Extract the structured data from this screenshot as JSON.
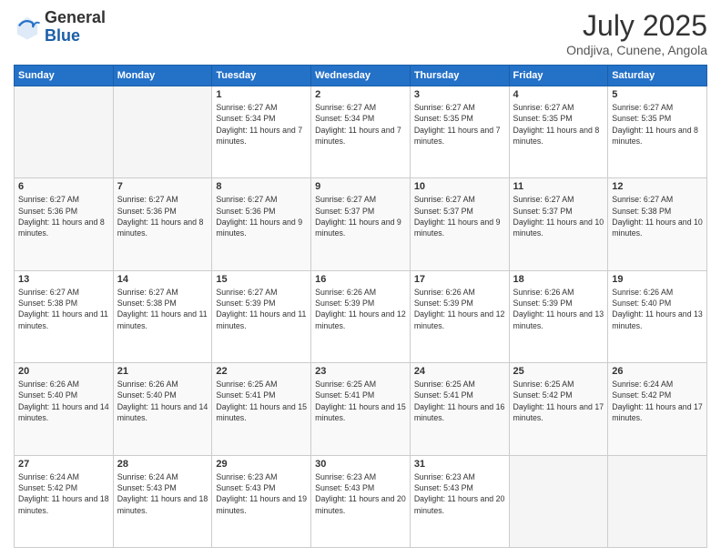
{
  "header": {
    "logo_line1": "General",
    "logo_line2": "Blue",
    "month": "July 2025",
    "location": "Ondjiva, Cunene, Angola"
  },
  "weekdays": [
    "Sunday",
    "Monday",
    "Tuesday",
    "Wednesday",
    "Thursday",
    "Friday",
    "Saturday"
  ],
  "weeks": [
    [
      {
        "day": "",
        "info": ""
      },
      {
        "day": "",
        "info": ""
      },
      {
        "day": "1",
        "info": "Sunrise: 6:27 AM\nSunset: 5:34 PM\nDaylight: 11 hours and 7 minutes."
      },
      {
        "day": "2",
        "info": "Sunrise: 6:27 AM\nSunset: 5:34 PM\nDaylight: 11 hours and 7 minutes."
      },
      {
        "day": "3",
        "info": "Sunrise: 6:27 AM\nSunset: 5:35 PM\nDaylight: 11 hours and 7 minutes."
      },
      {
        "day": "4",
        "info": "Sunrise: 6:27 AM\nSunset: 5:35 PM\nDaylight: 11 hours and 8 minutes."
      },
      {
        "day": "5",
        "info": "Sunrise: 6:27 AM\nSunset: 5:35 PM\nDaylight: 11 hours and 8 minutes."
      }
    ],
    [
      {
        "day": "6",
        "info": "Sunrise: 6:27 AM\nSunset: 5:36 PM\nDaylight: 11 hours and 8 minutes."
      },
      {
        "day": "7",
        "info": "Sunrise: 6:27 AM\nSunset: 5:36 PM\nDaylight: 11 hours and 8 minutes."
      },
      {
        "day": "8",
        "info": "Sunrise: 6:27 AM\nSunset: 5:36 PM\nDaylight: 11 hours and 9 minutes."
      },
      {
        "day": "9",
        "info": "Sunrise: 6:27 AM\nSunset: 5:37 PM\nDaylight: 11 hours and 9 minutes."
      },
      {
        "day": "10",
        "info": "Sunrise: 6:27 AM\nSunset: 5:37 PM\nDaylight: 11 hours and 9 minutes."
      },
      {
        "day": "11",
        "info": "Sunrise: 6:27 AM\nSunset: 5:37 PM\nDaylight: 11 hours and 10 minutes."
      },
      {
        "day": "12",
        "info": "Sunrise: 6:27 AM\nSunset: 5:38 PM\nDaylight: 11 hours and 10 minutes."
      }
    ],
    [
      {
        "day": "13",
        "info": "Sunrise: 6:27 AM\nSunset: 5:38 PM\nDaylight: 11 hours and 11 minutes."
      },
      {
        "day": "14",
        "info": "Sunrise: 6:27 AM\nSunset: 5:38 PM\nDaylight: 11 hours and 11 minutes."
      },
      {
        "day": "15",
        "info": "Sunrise: 6:27 AM\nSunset: 5:39 PM\nDaylight: 11 hours and 11 minutes."
      },
      {
        "day": "16",
        "info": "Sunrise: 6:26 AM\nSunset: 5:39 PM\nDaylight: 11 hours and 12 minutes."
      },
      {
        "day": "17",
        "info": "Sunrise: 6:26 AM\nSunset: 5:39 PM\nDaylight: 11 hours and 12 minutes."
      },
      {
        "day": "18",
        "info": "Sunrise: 6:26 AM\nSunset: 5:39 PM\nDaylight: 11 hours and 13 minutes."
      },
      {
        "day": "19",
        "info": "Sunrise: 6:26 AM\nSunset: 5:40 PM\nDaylight: 11 hours and 13 minutes."
      }
    ],
    [
      {
        "day": "20",
        "info": "Sunrise: 6:26 AM\nSunset: 5:40 PM\nDaylight: 11 hours and 14 minutes."
      },
      {
        "day": "21",
        "info": "Sunrise: 6:26 AM\nSunset: 5:40 PM\nDaylight: 11 hours and 14 minutes."
      },
      {
        "day": "22",
        "info": "Sunrise: 6:25 AM\nSunset: 5:41 PM\nDaylight: 11 hours and 15 minutes."
      },
      {
        "day": "23",
        "info": "Sunrise: 6:25 AM\nSunset: 5:41 PM\nDaylight: 11 hours and 15 minutes."
      },
      {
        "day": "24",
        "info": "Sunrise: 6:25 AM\nSunset: 5:41 PM\nDaylight: 11 hours and 16 minutes."
      },
      {
        "day": "25",
        "info": "Sunrise: 6:25 AM\nSunset: 5:42 PM\nDaylight: 11 hours and 17 minutes."
      },
      {
        "day": "26",
        "info": "Sunrise: 6:24 AM\nSunset: 5:42 PM\nDaylight: 11 hours and 17 minutes."
      }
    ],
    [
      {
        "day": "27",
        "info": "Sunrise: 6:24 AM\nSunset: 5:42 PM\nDaylight: 11 hours and 18 minutes."
      },
      {
        "day": "28",
        "info": "Sunrise: 6:24 AM\nSunset: 5:43 PM\nDaylight: 11 hours and 18 minutes."
      },
      {
        "day": "29",
        "info": "Sunrise: 6:23 AM\nSunset: 5:43 PM\nDaylight: 11 hours and 19 minutes."
      },
      {
        "day": "30",
        "info": "Sunrise: 6:23 AM\nSunset: 5:43 PM\nDaylight: 11 hours and 20 minutes."
      },
      {
        "day": "31",
        "info": "Sunrise: 6:23 AM\nSunset: 5:43 PM\nDaylight: 11 hours and 20 minutes."
      },
      {
        "day": "",
        "info": ""
      },
      {
        "day": "",
        "info": ""
      }
    ]
  ]
}
